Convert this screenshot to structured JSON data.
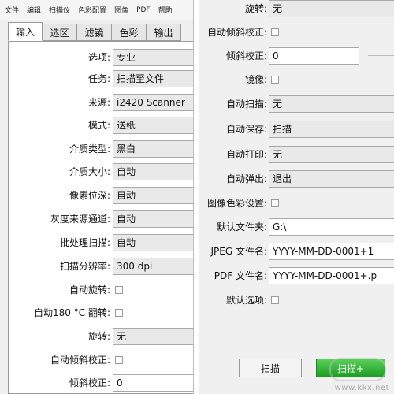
{
  "menubar": {
    "items": [
      "文件",
      "编辑",
      "扫描仪",
      "色彩配置",
      "图像",
      "PDF",
      "帮助"
    ]
  },
  "tabs": [
    "输入",
    "选区",
    "滤镜",
    "色彩",
    "输出"
  ],
  "left": {
    "rows": [
      {
        "label": "选项:",
        "value": "专业",
        "kind": "select"
      },
      {
        "label": "任务:",
        "value": "扫描至文件",
        "kind": "select"
      },
      {
        "label": "来源:",
        "value": "i2420 Scanner",
        "kind": "select"
      },
      {
        "label": "模式:",
        "value": "送纸",
        "kind": "select"
      },
      {
        "label": "介质类型:",
        "value": "黑白",
        "kind": "select"
      },
      {
        "label": "介质大小:",
        "value": "自动",
        "kind": "select"
      },
      {
        "label": "像素位深:",
        "value": "自动",
        "kind": "select"
      },
      {
        "label": "灰度来源通道:",
        "value": "自动",
        "kind": "select"
      },
      {
        "label": "批处理扫描:",
        "value": "自动",
        "kind": "select"
      },
      {
        "label": "扫描分辨率:",
        "value": "300 dpi",
        "kind": "select"
      },
      {
        "label": "自动旋转:",
        "value": "",
        "kind": "check"
      },
      {
        "label": "自动180 °C 翻转:",
        "value": "",
        "kind": "check"
      },
      {
        "label": "旋转:",
        "value": "无",
        "kind": "select"
      },
      {
        "label": "自动倾斜校正:",
        "value": "",
        "kind": "check"
      },
      {
        "label": "倾斜校正:",
        "value": "0",
        "kind": "field"
      }
    ]
  },
  "right": {
    "rows": [
      {
        "label": "旋转:",
        "value": "无",
        "kind": "select"
      },
      {
        "label": "自动倾斜校正:",
        "value": "",
        "kind": "check"
      },
      {
        "label": "倾斜校正:",
        "value": "0",
        "kind": "slider"
      },
      {
        "label": "镜像:",
        "value": "",
        "kind": "check"
      },
      {
        "label": "自动扫描:",
        "value": "无",
        "kind": "select"
      },
      {
        "label": "自动保存:",
        "value": "扫描",
        "kind": "select"
      },
      {
        "label": "自动打印:",
        "value": "无",
        "kind": "select"
      },
      {
        "label": "自动弹出:",
        "value": "退出",
        "kind": "select"
      },
      {
        "label": "图像色彩设置:",
        "value": "",
        "kind": "check"
      },
      {
        "label": "默认文件夹:",
        "value": "G:\\",
        "kind": "field"
      },
      {
        "label": "JPEG 文件名:",
        "value": "YYYY-MM-DD-0001+1",
        "kind": "field"
      },
      {
        "label": "PDF 文件名:",
        "value": "YYYY-MM-DD-0001+.p",
        "kind": "field"
      },
      {
        "label": "默认选项:",
        "value": "",
        "kind": "check"
      }
    ],
    "buttons": {
      "scan_label": "扫描",
      "scan_plus_label": "扫描+"
    }
  },
  "watermark": "www.kkx.net"
}
